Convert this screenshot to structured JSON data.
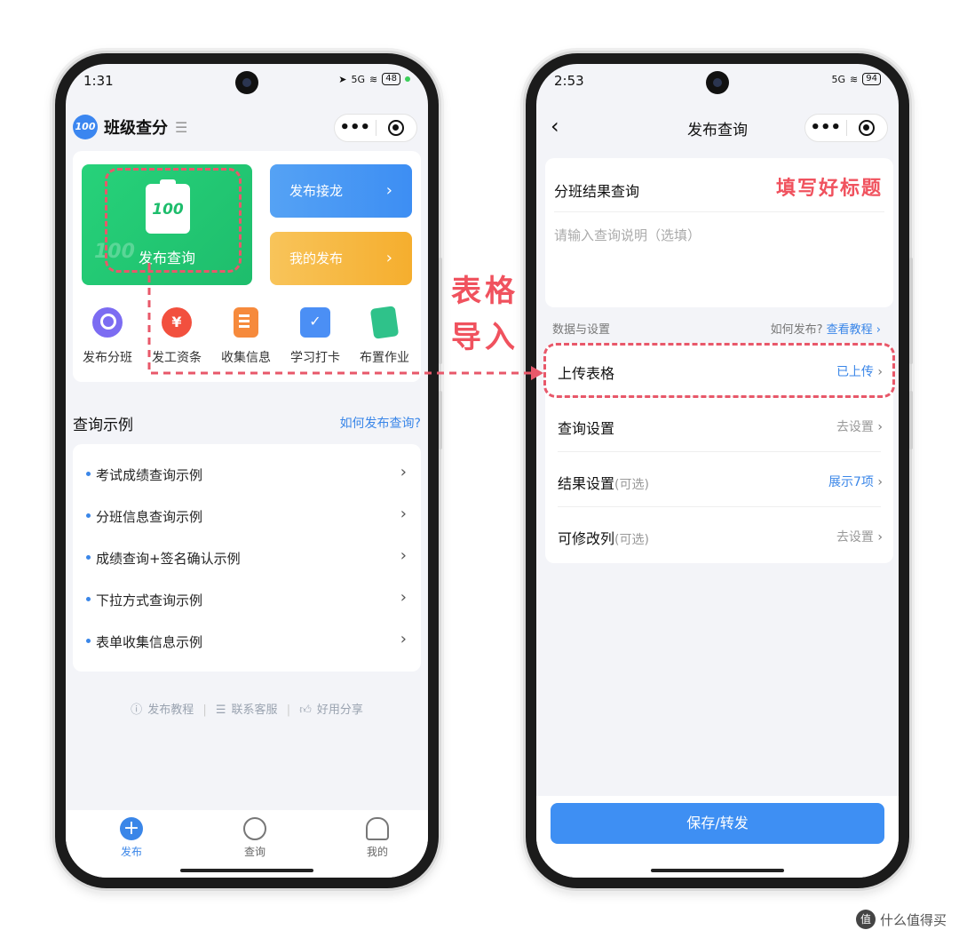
{
  "left_phone": {
    "status": {
      "time": "1:31",
      "signal": "5G",
      "battery": "48"
    },
    "app_title": "班级查分",
    "app_logo": "100",
    "feature_tiles": {
      "publish_query": "发布查询",
      "publish_query_badge": "100",
      "publish_jielong": "发布接龙",
      "my_publish": "我的发布"
    },
    "quick_icons": [
      {
        "label": "发布分班",
        "icon": "search-person-icon"
      },
      {
        "label": "发工资条",
        "icon": "yuan-refresh-icon"
      },
      {
        "label": "收集信息",
        "icon": "document-icon"
      },
      {
        "label": "学习打卡",
        "icon": "calendar-check-icon"
      },
      {
        "label": "布置作业",
        "icon": "book-icon"
      }
    ],
    "examples_title": "查询示例",
    "examples_help": "如何发布查询?",
    "examples": [
      "考试成绩查询示例",
      "分班信息查询示例",
      "成绩查询+签名确认示例",
      "下拉方式查询示例",
      "表单收集信息示例"
    ],
    "footer_links": [
      "发布教程",
      "联系客服",
      "好用分享"
    ],
    "tabs": [
      {
        "label": "发布",
        "icon": "plus-circle-icon",
        "active": true
      },
      {
        "label": "查询",
        "icon": "search-icon",
        "active": false
      },
      {
        "label": "我的",
        "icon": "user-icon",
        "active": false
      }
    ]
  },
  "right_phone": {
    "status": {
      "time": "2:53",
      "signal": "5G",
      "battery": "94"
    },
    "nav_title": "发布查询",
    "title_value": "分班结果查询",
    "desc_placeholder": "请输入查询说明（选填）",
    "data_section_label": "数据与设置",
    "data_help_prefix": "如何发布?",
    "data_help_link": "查看教程",
    "settings": [
      {
        "label": "上传表格",
        "optional": "",
        "value": "已上传",
        "highlight": true
      },
      {
        "label": "查询设置",
        "optional": "",
        "value": "去设置",
        "highlight": false
      },
      {
        "label": "结果设置",
        "optional": "(可选)",
        "value": "展示7项",
        "highlight": true
      },
      {
        "label": "可修改列",
        "optional": "(可选)",
        "value": "去设置",
        "highlight": false
      }
    ],
    "save_button": "保存/转发"
  },
  "annotations": {
    "title_note": "填写好标题",
    "import_line1": "表格",
    "import_line2": "导入",
    "accent_color": "#f0525e"
  },
  "watermark": {
    "icon_text": "值",
    "text": "什么值得买"
  },
  "colors": {
    "primary_blue": "#3a86e8",
    "green": "#1ebd6c",
    "orange": "#f5ae2e"
  }
}
